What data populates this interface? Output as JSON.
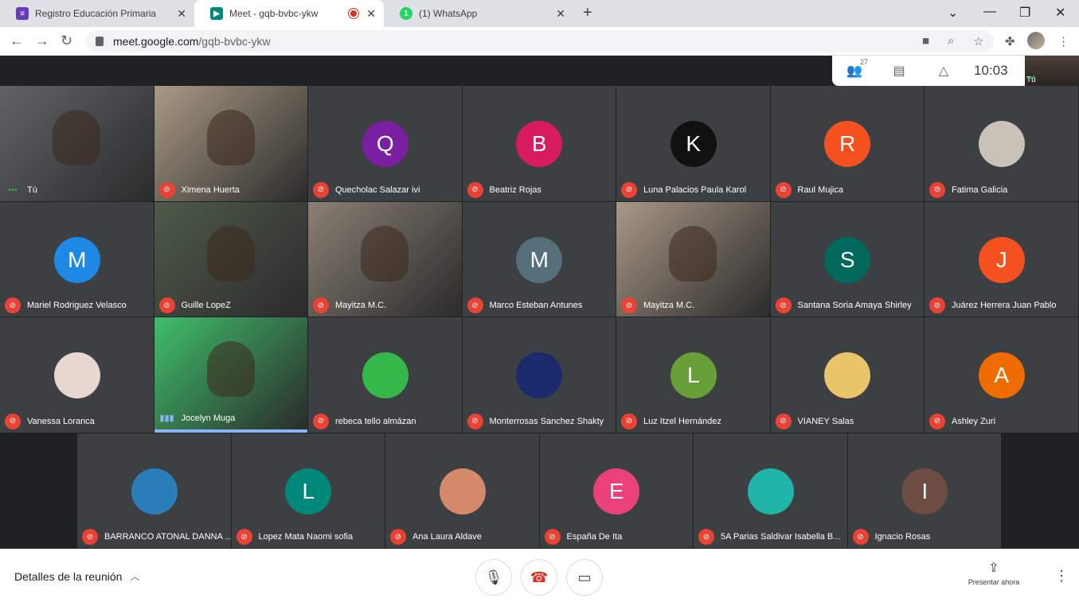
{
  "browser": {
    "tabs": [
      {
        "title": "Registro Educación Primaria",
        "icon": "forms-icon",
        "color": "#673ab7"
      },
      {
        "title": "Meet - gqb-bvbc-ykw",
        "icon": "meet-icon",
        "color": "#00897b"
      },
      {
        "title": "(1) WhatsApp",
        "icon": "whatsapp-icon",
        "color": "#25d366",
        "badge": "1"
      }
    ],
    "url_host": "meet.google.com",
    "url_path": "/gqb-bvbc-ykw"
  },
  "meeting": {
    "participant_count": "27",
    "time": "10:03",
    "self_label": "Tú"
  },
  "participants": [
    {
      "name": "Tú",
      "initial": "",
      "color": "#5f6368",
      "type": "video-self"
    },
    {
      "name": "Ximena Huerta",
      "initial": "",
      "color": "#a99a85",
      "type": "video"
    },
    {
      "name": "Quecholac Salazar ivi",
      "initial": "Q",
      "color": "#7b1fa2",
      "type": "avatar"
    },
    {
      "name": "Beatriz Rojas",
      "initial": "B",
      "color": "#d81b60",
      "type": "avatar"
    },
    {
      "name": "Luna Palacios Paula Karol",
      "initial": "K",
      "color": "#111111",
      "type": "avatar"
    },
    {
      "name": "Raul Mujica",
      "initial": "R",
      "color": "#f4511e",
      "type": "avatar"
    },
    {
      "name": "Fatima Galicia",
      "initial": "",
      "color": "#c9c2b8",
      "type": "photo"
    },
    {
      "name": "Mariel Rodriguez Velasco",
      "initial": "M",
      "color": "#1e88e5",
      "type": "avatar"
    },
    {
      "name": "Guille LopeZ",
      "initial": "",
      "color": "#4e5a4a",
      "type": "video"
    },
    {
      "name": "Mayitza M.C.",
      "initial": "",
      "color": "#8a8075",
      "type": "video"
    },
    {
      "name": "Marco Esteban Antunes",
      "initial": "M",
      "color": "#546e7a",
      "type": "avatar"
    },
    {
      "name": "Mayitza M.C.",
      "initial": "",
      "color": "#a89886",
      "type": "video"
    },
    {
      "name": "Santana Soria Amaya Shirley",
      "initial": "S",
      "color": "#00695c",
      "type": "avatar"
    },
    {
      "name": "Juárez Herrera Juan Pablo",
      "initial": "J",
      "color": "#f4511e",
      "type": "avatar"
    },
    {
      "name": "Vanessa Loranca",
      "initial": "",
      "color": "#e8d6d0",
      "type": "photo"
    },
    {
      "name": "Jocelyn Muga",
      "initial": "",
      "color": "#3fbf6a",
      "type": "video-speaking"
    },
    {
      "name": "rebeca tello almázan",
      "initial": "",
      "color": "#35b84a",
      "type": "photo"
    },
    {
      "name": "Monterrosas Sanchez Shakty",
      "initial": "",
      "color": "#1a2a6c",
      "type": "photo"
    },
    {
      "name": "Luz Itzel Hernández",
      "initial": "L",
      "color": "#689f38",
      "type": "avatar"
    },
    {
      "name": "VIANEY Salas",
      "initial": "",
      "color": "#e9c46a",
      "type": "photo"
    },
    {
      "name": "Ashley Zuri",
      "initial": "A",
      "color": "#ef6c00",
      "type": "avatar"
    },
    {
      "name": "BARRANCO ATONAL DANNA ...",
      "initial": "",
      "color": "#2a7fb8",
      "type": "photo"
    },
    {
      "name": "Lopez Mata Naomi sofia",
      "initial": "L",
      "color": "#00897b",
      "type": "avatar"
    },
    {
      "name": "Ana Laura Aldave",
      "initial": "",
      "color": "#d4896a",
      "type": "photo"
    },
    {
      "name": "España De Ita",
      "initial": "E",
      "color": "#ec407a",
      "type": "avatar"
    },
    {
      "name": "5A Parias Saldivar Isabella B...",
      "initial": "",
      "color": "#1fb5a9",
      "type": "photo"
    },
    {
      "name": "Ignacio Rosas",
      "initial": "I",
      "color": "#6d4c41",
      "type": "avatar"
    }
  ],
  "bottom": {
    "details": "Detalles de la reunión",
    "present": "Presentar ahora"
  }
}
